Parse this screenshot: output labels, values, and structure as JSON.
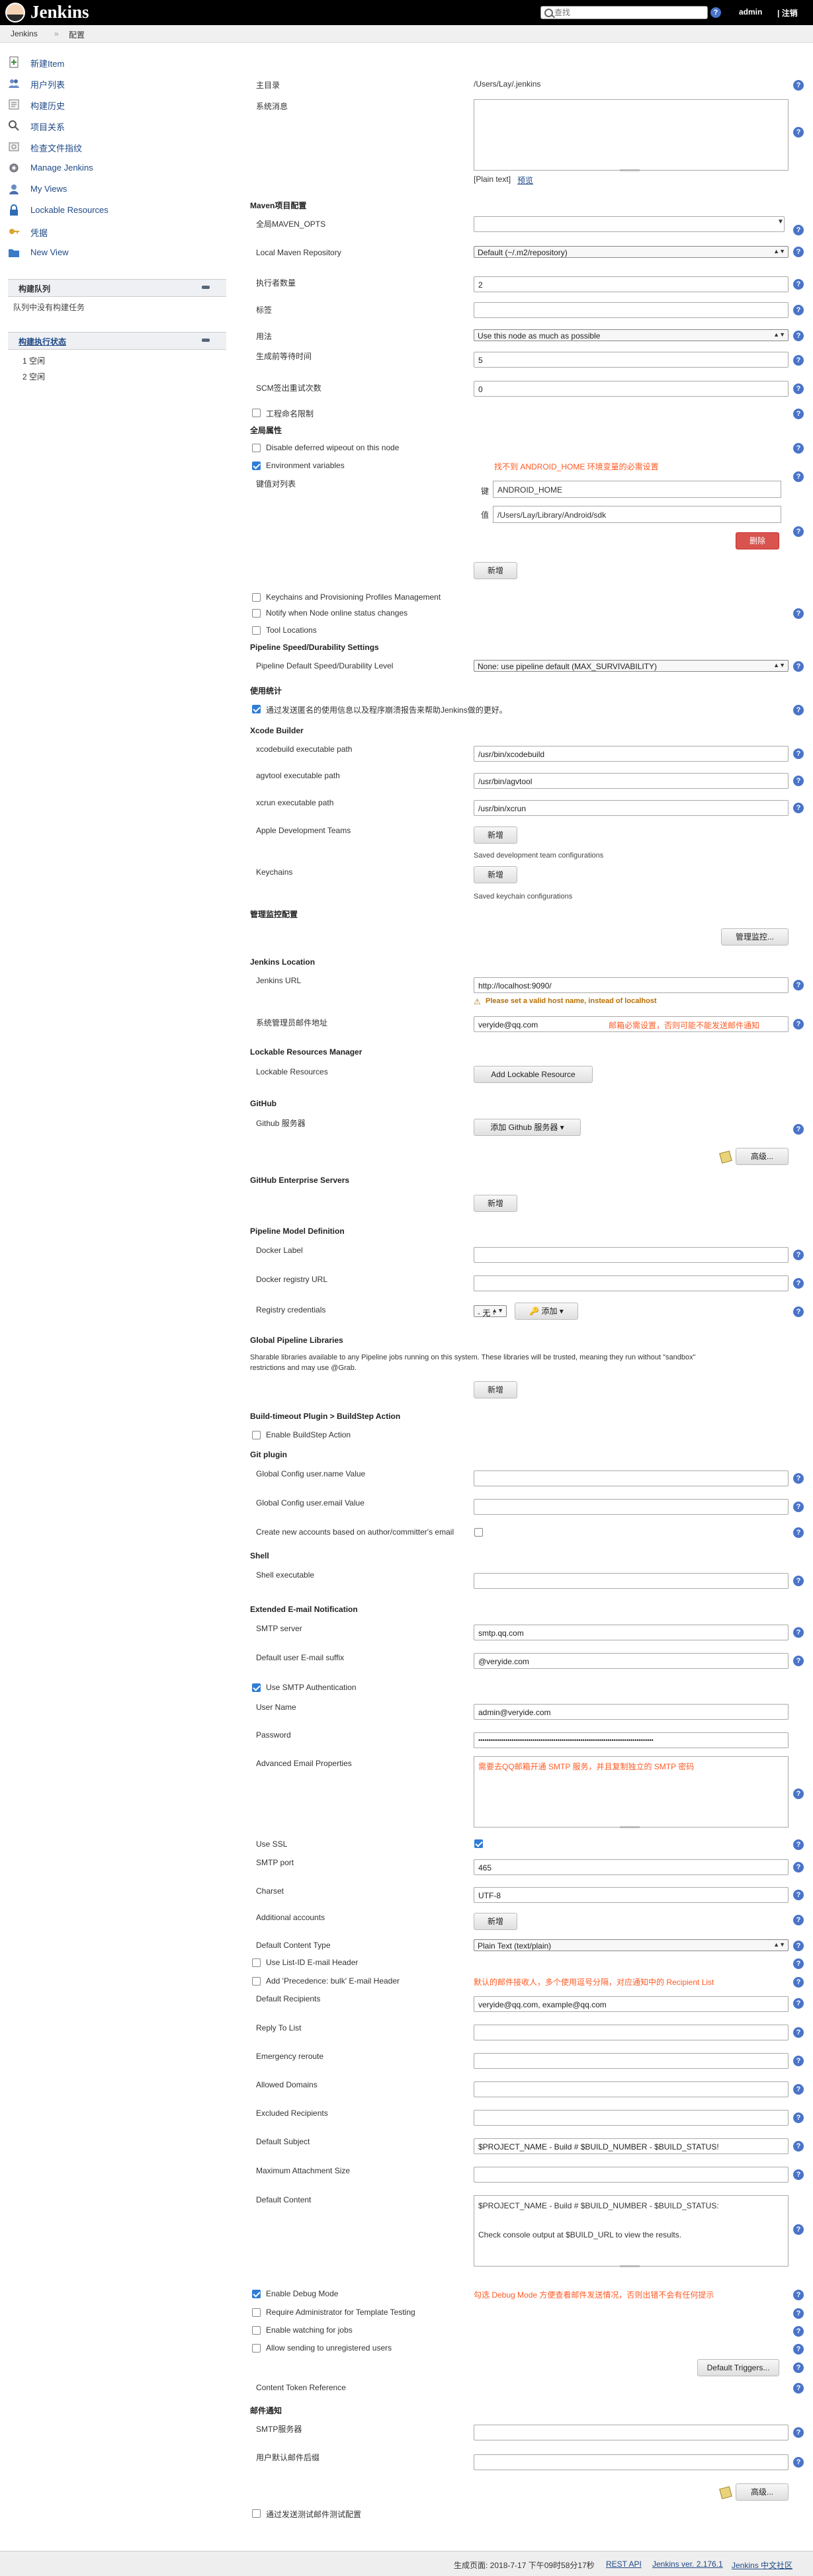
{
  "header": {
    "logo_text": "Jenkins",
    "search_placeholder": "查找",
    "help_icon": "?",
    "user": "admin",
    "logout": "| 注销"
  },
  "breadcrumb": [
    "Jenkins",
    "»",
    "配置"
  ],
  "sidebar": {
    "items": [
      {
        "label": "新建Item",
        "icon": "new-item-icon"
      },
      {
        "label": "用户列表",
        "icon": "people-icon"
      },
      {
        "label": "构建历史",
        "icon": "history-icon"
      },
      {
        "label": "项目关系",
        "icon": "search-icon"
      },
      {
        "label": "检查文件指纹",
        "icon": "fingerprint-icon"
      },
      {
        "label": "Manage Jenkins",
        "icon": "gear-icon"
      },
      {
        "label": "My Views",
        "icon": "user-icon"
      },
      {
        "label": "Lockable Resources",
        "icon": "lock-icon"
      },
      {
        "label": "凭据",
        "icon": "key-icon"
      },
      {
        "label": "New View",
        "icon": "folder-icon"
      }
    ],
    "queue": {
      "title": "构建队列",
      "empty": "队列中没有构建任务"
    },
    "executors": {
      "title": "构建执行状态",
      "rows": [
        "1  空闲",
        "2  空闲"
      ]
    }
  },
  "form": {
    "home_label": "主目录",
    "home_value": "/Users/Lay/.jenkins",
    "system_message_label": "系统消息",
    "plain_text": "[Plain text]",
    "preview": "预览",
    "maven_section": "Maven项目配置",
    "maven_opts_label": "全局MAVEN_OPTS",
    "local_maven_label": "Local Maven Repository",
    "local_maven_value": "Default (~/.m2/repository)",
    "executors_label": "执行者数量",
    "executors_value": "2",
    "labels_label": "标签",
    "usage_label": "用法",
    "usage_value": "Use this node as much as possible",
    "quiet_label": "生成前等待时间",
    "quiet_value": "5",
    "scm_label": "SCM签出重试次数",
    "scm_value": "0",
    "restrict_label": "工程命名限制",
    "global_props": "全局属性",
    "disable_wipeout": "Disable deferred wipeout on this node",
    "env_vars": "Environment variables",
    "kv_list": "键值对列表",
    "env_note": "找不到 ANDROID_HOME 环境变量的必需设置",
    "key_label": "键",
    "key_value": "ANDROID_HOME",
    "value_label": "值",
    "value_value": "/Users/Lay/Library/Android/sdk",
    "delete_button": "删除",
    "add_button": "新增",
    "keychains_mgmt": "Keychains and Provisioning Profiles Management",
    "notify_offline": "Notify when Node online status changes",
    "tool_locations": "Tool Locations",
    "pipeline_speed_section": "Pipeline Speed/Durability Settings",
    "pipeline_speed_label": "Pipeline Default Speed/Durability Level",
    "pipeline_speed_value": "None: use pipeline default (MAX_SURVIVABILITY)",
    "usage_stats_section": "使用统计",
    "usage_stats_check": "通过发送匿名的使用信息以及程序崩溃报告来帮助Jenkins做的更好。",
    "xcode_section": "Xcode Builder",
    "xcodebuild_label": "xcodebuild executable path",
    "xcodebuild_value": "/usr/bin/xcodebuild",
    "agvtool_label": "agvtool executable path",
    "agvtool_value": "/usr/bin/agvtool",
    "xcrun_label": "xcrun executable path",
    "xcrun_value": "/usr/bin/xcrun",
    "apple_teams_label": "Apple Development Teams",
    "saved_teams": "Saved development team configurations",
    "keychains_label": "Keychains",
    "saved_keychains": "Saved keychain configurations",
    "monitor_section": "管理监控配置",
    "monitor_button": "管理监控...",
    "location_section": "Jenkins Location",
    "jenkins_url_label": "Jenkins URL",
    "jenkins_url_value": "http://localhost:9090/",
    "url_warning": "Please set a valid host name, instead of localhost",
    "admin_email_label": "系统管理员邮件地址",
    "admin_email_value": "veryide@qq.com",
    "admin_email_note": "邮箱必需设置，否则可能不能发送邮件通知",
    "lockable_section": "Lockable Resources Manager",
    "lockable_label": "Lockable Resources",
    "lockable_button": "Add Lockable Resource",
    "github_section": "GitHub",
    "github_label": "Github 服务器",
    "github_button": "添加 Github 服务器",
    "advanced_button": "高级...",
    "ghe_section": "GitHub Enterprise Servers",
    "pmd_section": "Pipeline Model Definition",
    "docker_label": "Docker Label",
    "docker_registry_label": "Docker registry URL",
    "registry_creds_label": "Registry credentials",
    "none_option": "- 无 -",
    "add_cred_button": "添加",
    "gpl_section": "Global Pipeline Libraries",
    "gpl_desc_1": "Sharable libraries available to any Pipeline jobs running on this system. These libraries will be trusted, meaning they run without \"sandbox\"",
    "gpl_desc_2": "restrictions and may use @Grab.",
    "timeout_section": "Build-timeout Plugin > BuildStep Action",
    "enable_buildstep": "Enable BuildStep Action",
    "git_section": "Git plugin",
    "git_name_label": "Global Config user.name Value",
    "git_email_label": "Global Config user.email Value",
    "create_accounts": "Create new accounts based on author/committer's email",
    "shell_section": "Shell",
    "shell_label": "Shell executable",
    "email_ext_section": "Extended E-mail Notification",
    "smtp_server_label": "SMTP server",
    "smtp_server_value": "smtp.qq.com",
    "suffix_label": "Default user E-mail suffix",
    "suffix_value": "@veryide.com",
    "use_smtp_auth": "Use SMTP Authentication",
    "username_label": "User Name",
    "username_value": "admin@veryide.com",
    "password_label": "Password",
    "password_value": "••••••••••••••••••••••••••••••••••••••••••••••••••••••••••••••••••••••••••••••••••••",
    "adv_props_label": "Advanced Email Properties",
    "smtp_note": "需要去QQ邮箱开通 SMTP 服务，并且复制独立的 SMTP 密码",
    "use_ssl_label": "Use SSL",
    "smtp_port_label": "SMTP port",
    "smtp_port_value": "465",
    "charset_label": "Charset",
    "charset_value": "UTF-8",
    "additional_accounts_label": "Additional accounts",
    "content_type_label": "Default Content Type",
    "content_type_value": "Plain Text (text/plain)",
    "use_list_id": "Use List-ID E-mail Header",
    "add_precedence": "Add 'Precedence: bulk' E-mail Header",
    "recipients_note": "默认的邮件接收人，多个使用逗号分隔，对应通知中的 Recipient List",
    "recipients_label": "Default Recipients",
    "recipients_value": "veryide@qq.com, example@qq.com",
    "reply_to_label": "Reply To List",
    "emergency_label": "Emergency reroute",
    "allowed_domains_label": "Allowed Domains",
    "excluded_label": "Excluded Recipients",
    "subject_label": "Default Subject",
    "subject_value": "$PROJECT_NAME - Build # $BUILD_NUMBER - $BUILD_STATUS!",
    "max_attach_label": "Maximum Attachment Size",
    "content_label": "Default Content",
    "content_line1": "$PROJECT_NAME - Build # $BUILD_NUMBER - $BUILD_STATUS:",
    "content_line2": "Check console output at $BUILD_URL to view the results.",
    "enable_debug": "Enable Debug Mode",
    "debug_note": "勾选 Debug Mode 方便查看邮件发送情况，否则出错不会有任何提示",
    "require_admin": "Require Administrator for Template Testing",
    "enable_watching": "Enable watching for jobs",
    "allow_unregistered": "Allow sending to unregistered users",
    "default_triggers": "Default Triggers...",
    "content_token": "Content Token Reference",
    "mail_section": "邮件通知",
    "mail_smtp_label": "SMTP服务器",
    "mail_suffix_label": "用户默认邮件后缀",
    "test_config": "通过发送测试邮件测试配置"
  },
  "footer": {
    "generated": "生成页面: 2018-7-17 下午09时58分17秒",
    "rest_api": "REST API",
    "version": "Jenkins ver. 2.176.1",
    "chinese": "Jenkins 中文社区"
  }
}
